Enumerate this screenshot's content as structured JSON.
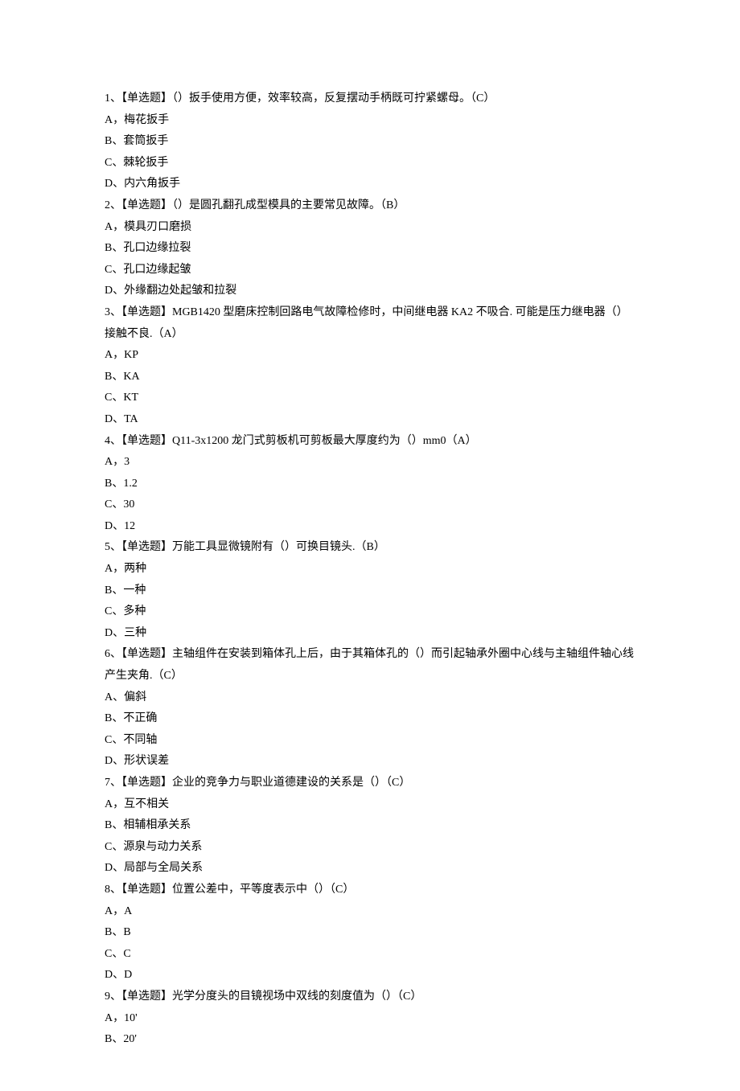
{
  "questions": [
    {
      "prompt": "1、【单选题】（）扳手使用方便，效率较高，反复摆动手柄既可拧紧螺母。（C）",
      "options": [
        "A，梅花扳手",
        "B、套筒扳手",
        "C、棘轮扳手",
        "D、内六角扳手"
      ]
    },
    {
      "prompt": "2、【单选题】（）是圆孔翻孔成型模具的主要常见故障。（B）",
      "options": [
        "A，模具刃口磨损",
        "B、孔口边缘拉裂",
        "C、孔口边缘起皱",
        "D、外缘翻边处起皱和拉裂"
      ]
    },
    {
      "prompt": "3、【单选题】MGB1420 型磨床控制回路电气故障检修时，中间继电器 KA2 不吸合. 可能是压力继电器（）接触不良.（A）",
      "options": [
        "A，KP",
        "B、KA",
        "C、KT",
        "D、TA"
      ]
    },
    {
      "prompt": "4、【单选题】Q11-3x1200 龙门式剪板机可剪板最大厚度约为（）mm0（A）",
      "options": [
        "A，3",
        "B、1.2",
        "C、30",
        "D、12"
      ]
    },
    {
      "prompt": "5、【单选题】万能工具显微镜附有（）可换目镜头.（B）",
      "options": [
        "A，两种",
        "B、一种",
        "C、多种",
        "D、三种"
      ]
    },
    {
      "prompt": "6、【单选题】主轴组件在安装到箱体孔上后，由于其箱体孔的（）而引起轴承外圈中心线与主轴组件轴心线产生夹角.（C）",
      "options": [
        "A、偏斜",
        "B、不正确",
        "C、不同轴",
        "D、形状误差"
      ]
    },
    {
      "prompt": "7、【单选题】企业的竞争力与职业道德建设的关系是（）（C）",
      "options": [
        "A，互不相关",
        "B、相辅相承关系",
        "C、源泉与动力关系",
        "D、局部与全局关系"
      ]
    },
    {
      "prompt": "8、【单选题】位置公差中，平等度表示中（）（C）",
      "options": [
        "A，A",
        "B、B",
        "C、C",
        "D、D"
      ]
    },
    {
      "prompt": "9、【单选题】光学分度头的目镜视场中双线的刻度值为（）（C）",
      "options": [
        "A，10'",
        "B、20'"
      ]
    }
  ]
}
